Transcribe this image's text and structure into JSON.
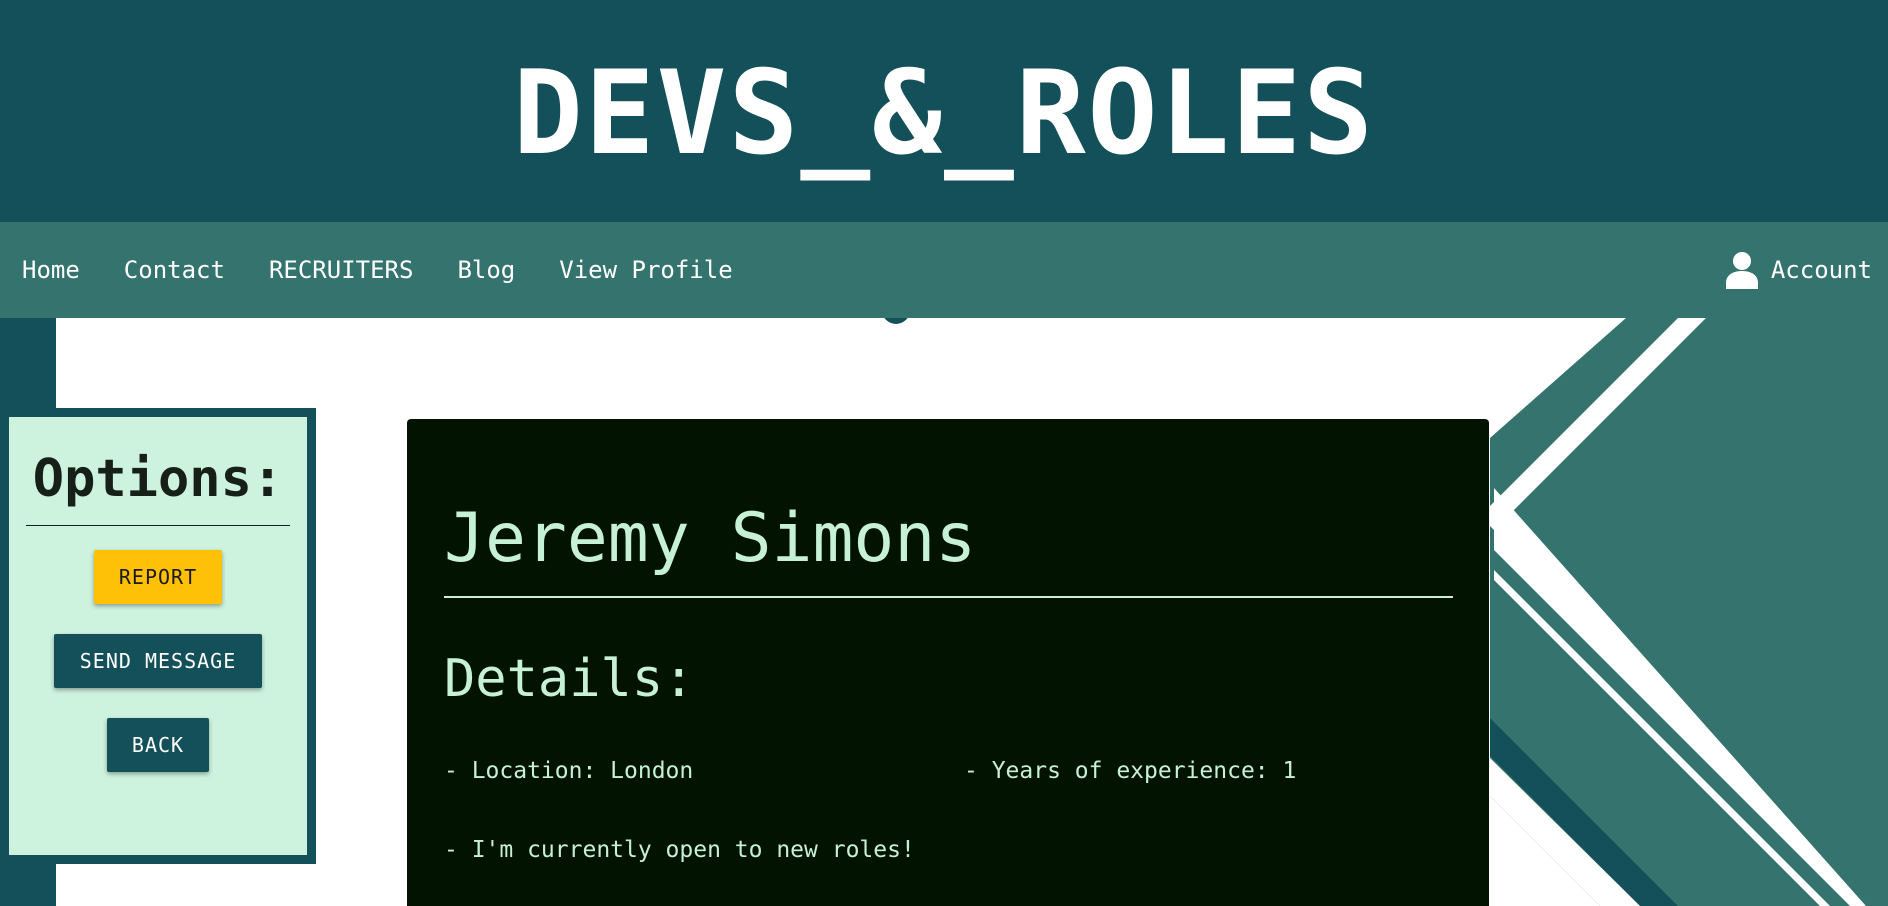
{
  "header": {
    "title": "DEVS_&_ROLES"
  },
  "nav": {
    "links": [
      "Home",
      "Contact",
      "RECRUITERS",
      "Blog",
      "View Profile"
    ],
    "account_label": "Account",
    "account_icon": "user-icon"
  },
  "options": {
    "title": "Options:",
    "report_label": "REPORT",
    "send_message_label": "SEND MESSAGE",
    "back_label": "BACK"
  },
  "profile": {
    "name": "Jeremy Simons",
    "details_heading": "Details:",
    "location": "- Location: London",
    "experience": "- Years of experience: 1",
    "availability": "- I'm currently open to new roles!"
  },
  "colors": {
    "header_bg": "#145059",
    "nav_bg": "#35746e",
    "options_bg": "#cdf2dd",
    "report_button": "#ffc107",
    "card_bg": "#021302",
    "card_text": "#c6f1d6"
  }
}
